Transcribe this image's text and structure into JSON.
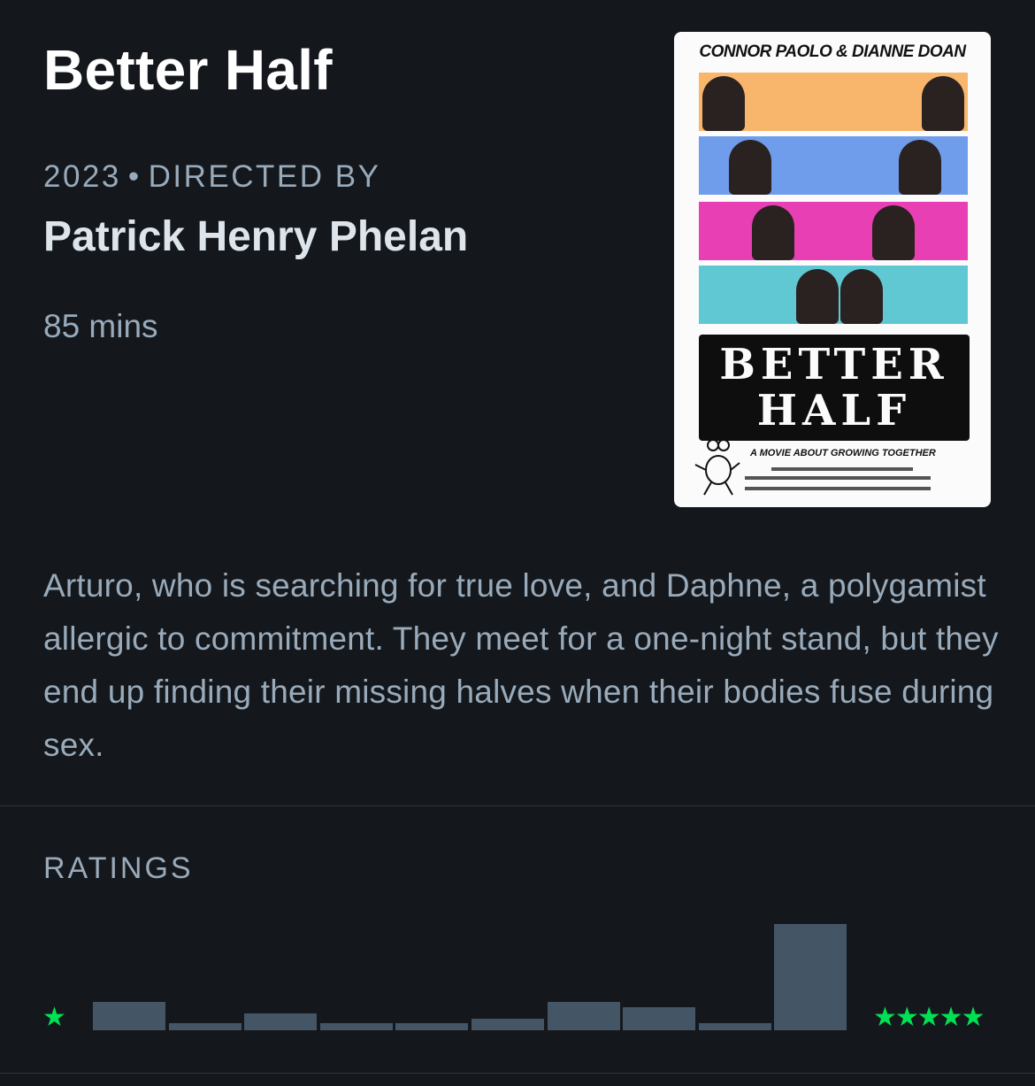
{
  "film": {
    "title": "Better Half",
    "year": "2023",
    "directed_by_label": "DIRECTED BY",
    "director": "Patrick Henry Phelan",
    "runtime": "85 mins",
    "synopsis": "Arturo, who is searching for true love, and Daphne, a polygamist allergic to commitment. They meet for a one-night stand, but they end up finding their missing halves when their bodies fuse during sex."
  },
  "poster": {
    "billing": "CONNOR PAOLO & DIANNE DOAN",
    "title_line1": "BETTER",
    "title_line2": "HALF",
    "tagline": "A MOVIE ABOUT GROWING TOGETHER",
    "stripe_colors": [
      "#f8b66c",
      "#6f9ceb",
      "#e83fb4",
      "#5fc8d3"
    ]
  },
  "ratings": {
    "label": "RATINGS",
    "min_icon": "single-star-icon",
    "max_icon": "five-stars-icon",
    "star_color": "#00e054",
    "bar_color": "#445566",
    "histogram": [
      0.27,
      0.06,
      0.16,
      0.06,
      0.06,
      0.11,
      0.27,
      0.22,
      0.06,
      1.0
    ]
  }
}
